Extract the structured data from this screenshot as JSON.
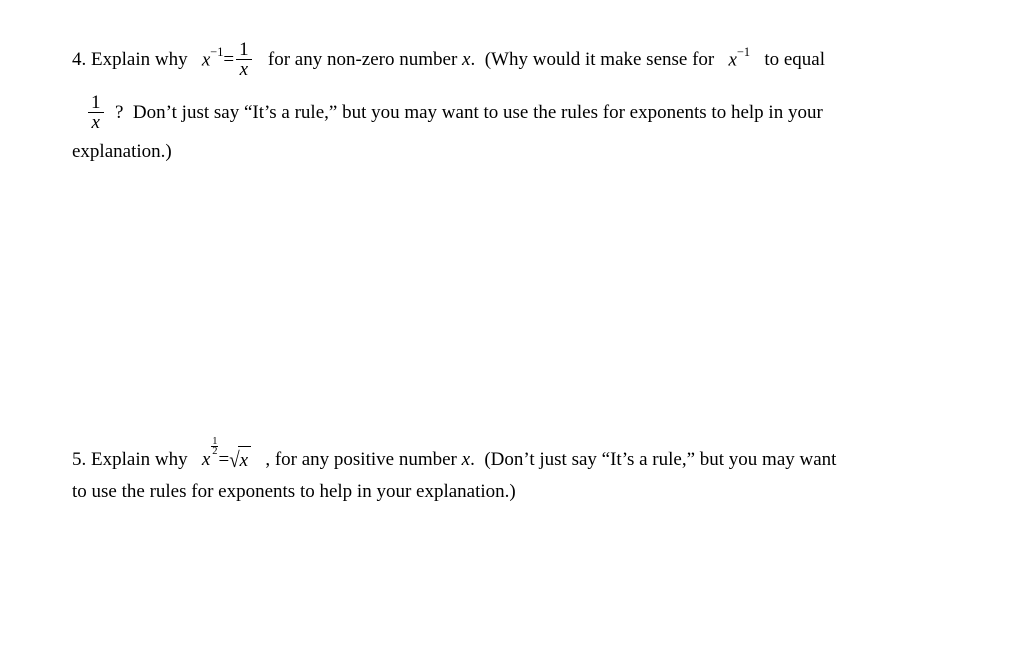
{
  "q4": {
    "num": "4.",
    "t1": " Explain why   ",
    "var_x": "x",
    "exp_neg1": "−1",
    "eq": "=",
    "frac1_num": "1",
    "frac1_den": "x",
    "t2": "   for any non-zero number ",
    "var_x2": "x",
    "t3": ".  (Why would it make sense for   ",
    "var_x3": "x",
    "exp_neg1b": "−1",
    "t4": "   to equal",
    "frac2_num": "1",
    "frac2_den": "x",
    "t5": "  ?  Don’t just say “It’s a rule,” but you may want to use the rules for exponents to help in your",
    "t6": "explanation.)"
  },
  "q5": {
    "num": "5.",
    "t1": " Explain why   ",
    "var_x": "x",
    "exp_half_num": "1",
    "exp_half_den": "2",
    "eq": "=",
    "sqrt_sym": "√",
    "sqrt_rad": "x",
    "t2": "   , for any positive number ",
    "var_x2": "x",
    "t3": ".  (Don’t just say “It’s a rule,” but you may want",
    "t4": "to use the rules for exponents to help in your explanation.)"
  }
}
